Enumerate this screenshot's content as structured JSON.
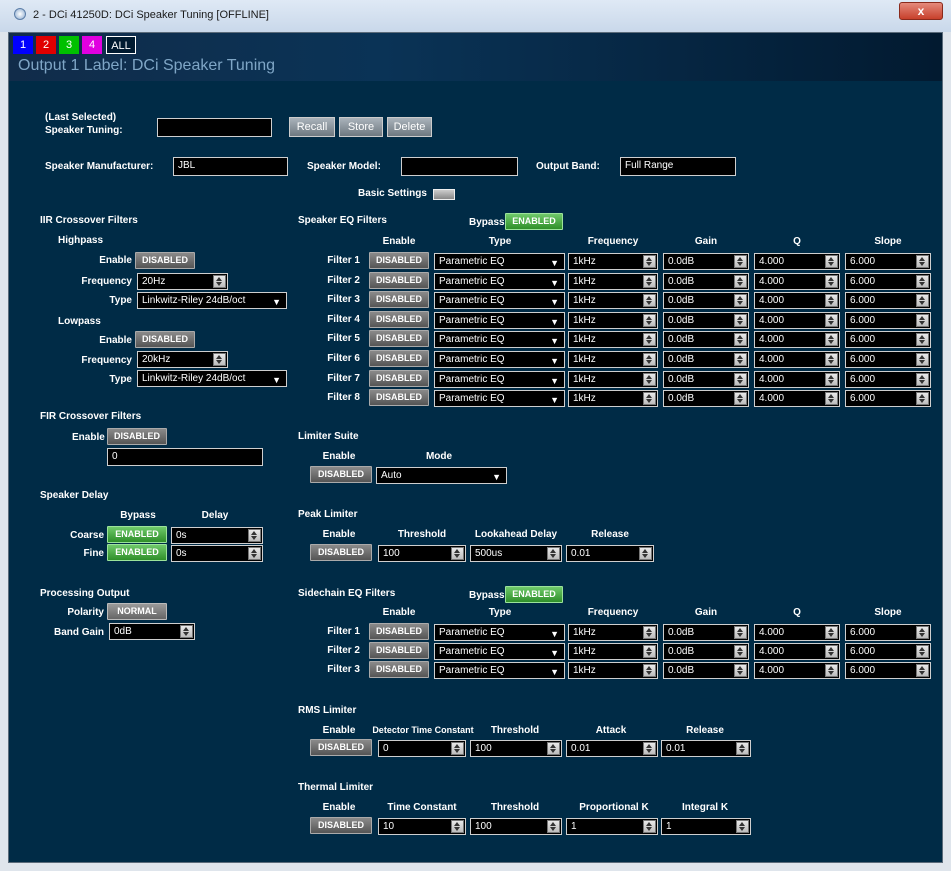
{
  "window": {
    "title": "2 - DCi 41250D: DCi Speaker Tuning [OFFLINE]",
    "close_label": "x"
  },
  "tabs": [
    {
      "label": "1",
      "color": "#0000ff"
    },
    {
      "label": "2",
      "color": "#e00000"
    },
    {
      "label": "3",
      "color": "#00c000"
    },
    {
      "label": "4",
      "color": "#e000e0"
    },
    {
      "label": "ALL",
      "color": "#001a30"
    }
  ],
  "output_label": "Output 1 Label: DCi Speaker Tuning",
  "tuning": {
    "label_line1": "(Last Selected)",
    "label_line2": "Speaker Tuning:",
    "value": "",
    "recall": "Recall",
    "store": "Store",
    "delete": "Delete"
  },
  "speaker": {
    "manufacturer_label": "Speaker Manufacturer:",
    "manufacturer": "JBL",
    "model_label": "Speaker Model:",
    "model": "",
    "band_label": "Output Band:",
    "band": "Full Range",
    "basic_settings": "Basic Settings"
  },
  "iir": {
    "title": "IIR Crossover Filters",
    "highpass": "Highpass",
    "lowpass": "Lowpass",
    "enable_label": "Enable",
    "frequency_label": "Frequency",
    "type_label": "Type",
    "hp_enable": "DISABLED",
    "hp_frequency": "20Hz",
    "hp_type": "Linkwitz-Riley 24dB/oct",
    "lp_enable": "DISABLED",
    "lp_frequency": "20kHz",
    "lp_type": "Linkwitz-Riley 24dB/oct"
  },
  "fir": {
    "title": "FIR Crossover Filters",
    "enable_label": "Enable",
    "enable": "DISABLED",
    "value": "0"
  },
  "delay": {
    "title": "Speaker Delay",
    "bypass_label": "Bypass",
    "delay_label": "Delay",
    "coarse_label": "Coarse",
    "fine_label": "Fine",
    "coarse_bypass": "ENABLED",
    "coarse_value": "0s",
    "fine_bypass": "ENABLED",
    "fine_value": "0s"
  },
  "processing": {
    "title": "Processing Output",
    "polarity_label": "Polarity",
    "polarity": "NORMAL",
    "band_gain_label": "Band Gain",
    "band_gain": "0dB"
  },
  "eq": {
    "title": "Speaker EQ Filters",
    "bypass_label": "Bypass",
    "bypass": "ENABLED",
    "headers": {
      "enable": "Enable",
      "type": "Type",
      "frequency": "Frequency",
      "gain": "Gain",
      "q": "Q",
      "slope": "Slope"
    },
    "filters": [
      {
        "label": "Filter 1",
        "enable": "DISABLED",
        "type": "Parametric EQ",
        "frequency": "1kHz",
        "gain": "0.0dB",
        "q": "4.000",
        "slope": "6.000"
      },
      {
        "label": "Filter 2",
        "enable": "DISABLED",
        "type": "Parametric EQ",
        "frequency": "1kHz",
        "gain": "0.0dB",
        "q": "4.000",
        "slope": "6.000"
      },
      {
        "label": "Filter 3",
        "enable": "DISABLED",
        "type": "Parametric EQ",
        "frequency": "1kHz",
        "gain": "0.0dB",
        "q": "4.000",
        "slope": "6.000"
      },
      {
        "label": "Filter 4",
        "enable": "DISABLED",
        "type": "Parametric EQ",
        "frequency": "1kHz",
        "gain": "0.0dB",
        "q": "4.000",
        "slope": "6.000"
      },
      {
        "label": "Filter 5",
        "enable": "DISABLED",
        "type": "Parametric EQ",
        "frequency": "1kHz",
        "gain": "0.0dB",
        "q": "4.000",
        "slope": "6.000"
      },
      {
        "label": "Filter 6",
        "enable": "DISABLED",
        "type": "Parametric EQ",
        "frequency": "1kHz",
        "gain": "0.0dB",
        "q": "4.000",
        "slope": "6.000"
      },
      {
        "label": "Filter 7",
        "enable": "DISABLED",
        "type": "Parametric EQ",
        "frequency": "1kHz",
        "gain": "0.0dB",
        "q": "4.000",
        "slope": "6.000"
      },
      {
        "label": "Filter 8",
        "enable": "DISABLED",
        "type": "Parametric EQ",
        "frequency": "1kHz",
        "gain": "0.0dB",
        "q": "4.000",
        "slope": "6.000"
      }
    ]
  },
  "limiter_suite": {
    "title": "Limiter Suite",
    "enable_label": "Enable",
    "mode_label": "Mode",
    "enable": "DISABLED",
    "mode": "Auto"
  },
  "peak": {
    "title": "Peak Limiter",
    "enable_label": "Enable",
    "threshold_label": "Threshold",
    "lookahead_label": "Lookahead Delay",
    "release_label": "Release",
    "enable": "DISABLED",
    "threshold": "100",
    "lookahead": "500us",
    "release": "0.01"
  },
  "sidechain": {
    "title": "Sidechain EQ Filters",
    "bypass_label": "Bypass",
    "bypass": "ENABLED",
    "filters": [
      {
        "label": "Filter 1",
        "enable": "DISABLED",
        "type": "Parametric EQ",
        "frequency": "1kHz",
        "gain": "0.0dB",
        "q": "4.000",
        "slope": "6.000"
      },
      {
        "label": "Filter 2",
        "enable": "DISABLED",
        "type": "Parametric EQ",
        "frequency": "1kHz",
        "gain": "0.0dB",
        "q": "4.000",
        "slope": "6.000"
      },
      {
        "label": "Filter 3",
        "enable": "DISABLED",
        "type": "Parametric EQ",
        "frequency": "1kHz",
        "gain": "0.0dB",
        "q": "4.000",
        "slope": "6.000"
      }
    ]
  },
  "rms": {
    "title": "RMS Limiter",
    "enable_label": "Enable",
    "detector_label": "Detector Time Constant",
    "threshold_label": "Threshold",
    "attack_label": "Attack",
    "release_label": "Release",
    "enable": "DISABLED",
    "detector": "0",
    "threshold": "100",
    "attack": "0.01",
    "release": "0.01"
  },
  "thermal": {
    "title": "Thermal Limiter",
    "enable_label": "Enable",
    "time_label": "Time Constant",
    "threshold_label": "Threshold",
    "prop_label": "Proportional K",
    "integral_label": "Integral K",
    "enable": "DISABLED",
    "time": "10",
    "threshold": "100",
    "prop": "1",
    "integral": "1"
  }
}
